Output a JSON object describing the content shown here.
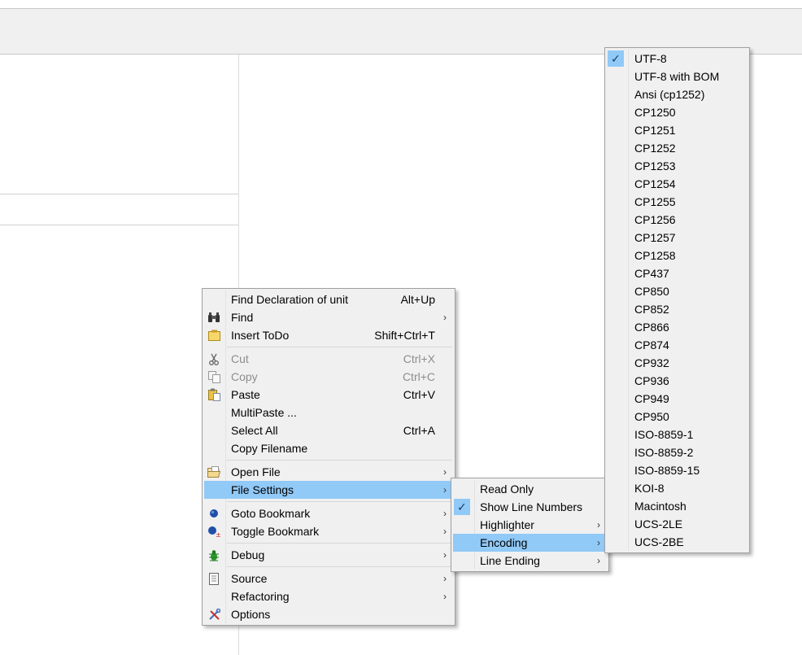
{
  "main_menu": {
    "items": [
      {
        "label": "Find Declaration of unit",
        "shortcut": "Alt+Up"
      },
      {
        "label": "Find"
      },
      {
        "label": "Insert ToDo",
        "shortcut": "Shift+Ctrl+T"
      },
      {
        "label": "Cut",
        "shortcut": "Ctrl+X"
      },
      {
        "label": "Copy",
        "shortcut": "Ctrl+C"
      },
      {
        "label": "Paste",
        "shortcut": "Ctrl+V"
      },
      {
        "label": "MultiPaste ..."
      },
      {
        "label": "Select All",
        "shortcut": "Ctrl+A"
      },
      {
        "label": "Copy Filename"
      },
      {
        "label": "Open File"
      },
      {
        "label": "File Settings"
      },
      {
        "label": "Goto Bookmark"
      },
      {
        "label": "Toggle Bookmark"
      },
      {
        "label": "Debug"
      },
      {
        "label": "Source"
      },
      {
        "label": "Refactoring"
      },
      {
        "label": "Options"
      }
    ]
  },
  "file_settings_menu": {
    "items": [
      {
        "label": "Read Only"
      },
      {
        "label": "Show Line Numbers",
        "checked": true
      },
      {
        "label": "Highlighter"
      },
      {
        "label": "Encoding"
      },
      {
        "label": "Line Ending"
      }
    ]
  },
  "encoding_menu": {
    "selected": "UTF-8",
    "items": [
      "UTF-8",
      "UTF-8 with BOM",
      "Ansi (cp1252)",
      "CP1250",
      "CP1251",
      "CP1252",
      "CP1253",
      "CP1254",
      "CP1255",
      "CP1256",
      "CP1257",
      "CP1258",
      "CP437",
      "CP850",
      "CP852",
      "CP866",
      "CP874",
      "CP932",
      "CP936",
      "CP949",
      "CP950",
      "ISO-8859-1",
      "ISO-8859-2",
      "ISO-8859-15",
      "KOI-8",
      "Macintosh",
      "UCS-2LE",
      "UCS-2BE"
    ]
  },
  "colors": {
    "menu_bg": "#f0f0f0",
    "highlight": "#91c9f7",
    "disabled_text": "#8d8d8d"
  }
}
